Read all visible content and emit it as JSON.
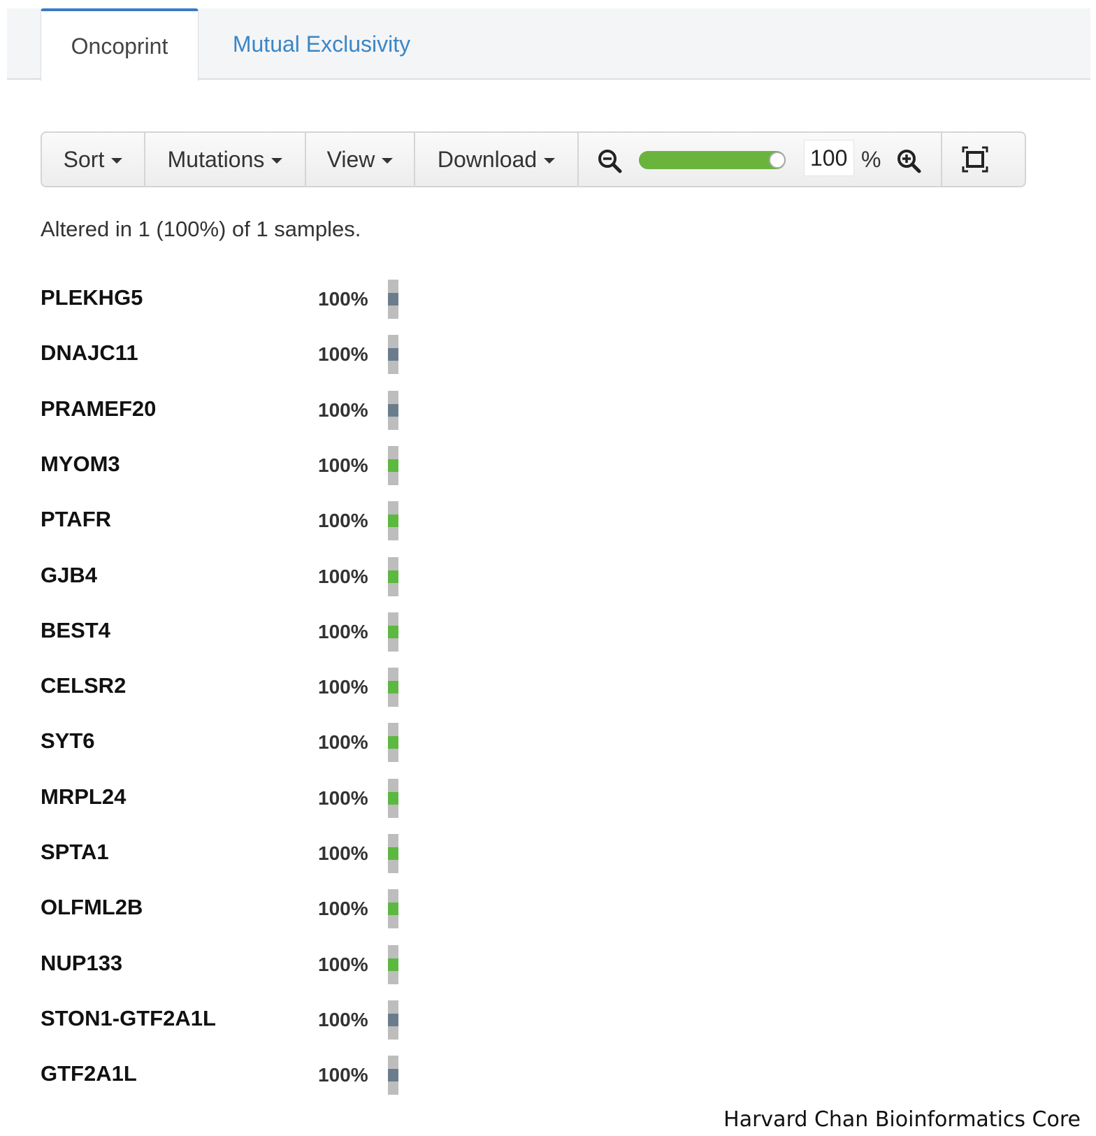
{
  "tabs": [
    {
      "label": "Oncoprint",
      "active": true
    },
    {
      "label": "Mutual Exclusivity",
      "active": false
    }
  ],
  "toolbar": {
    "sort_label": "Sort",
    "mutations_label": "Mutations",
    "view_label": "View",
    "download_label": "Download",
    "zoom_value": "100",
    "zoom_unit": "%",
    "zoom_level": 1.0,
    "zoom_out_icon": "zoom-out-icon",
    "zoom_in_icon": "zoom-in-icon",
    "fit_icon": "fit-to-screen-icon"
  },
  "summary": "Altered in 1 (100%) of 1 samples.",
  "colors": {
    "tab_active_border": "#3a7ac4",
    "tab_link": "#3a86c8",
    "slider_fill": "#6ab43e",
    "cell_background": "#bdbdbd",
    "alteration_gray": "#6b7c8c",
    "alteration_green": "#5cb840"
  },
  "genes": [
    {
      "name": "PLEKHG5",
      "percent": "100%",
      "alteration": "gray"
    },
    {
      "name": "DNAJC11",
      "percent": "100%",
      "alteration": "gray"
    },
    {
      "name": "PRAMEF20",
      "percent": "100%",
      "alteration": "gray"
    },
    {
      "name": "MYOM3",
      "percent": "100%",
      "alteration": "green"
    },
    {
      "name": "PTAFR",
      "percent": "100%",
      "alteration": "green"
    },
    {
      "name": "GJB4",
      "percent": "100%",
      "alteration": "green"
    },
    {
      "name": "BEST4",
      "percent": "100%",
      "alteration": "green"
    },
    {
      "name": "CELSR2",
      "percent": "100%",
      "alteration": "green"
    },
    {
      "name": "SYT6",
      "percent": "100%",
      "alteration": "green"
    },
    {
      "name": "MRPL24",
      "percent": "100%",
      "alteration": "green"
    },
    {
      "name": "SPTA1",
      "percent": "100%",
      "alteration": "green"
    },
    {
      "name": "OLFML2B",
      "percent": "100%",
      "alteration": "green"
    },
    {
      "name": "NUP133",
      "percent": "100%",
      "alteration": "green"
    },
    {
      "name": "STON1-GTF2A1L",
      "percent": "100%",
      "alteration": "gray"
    },
    {
      "name": "GTF2A1L",
      "percent": "100%",
      "alteration": "gray"
    }
  ],
  "credit": "Harvard Chan Bioinformatics Core"
}
